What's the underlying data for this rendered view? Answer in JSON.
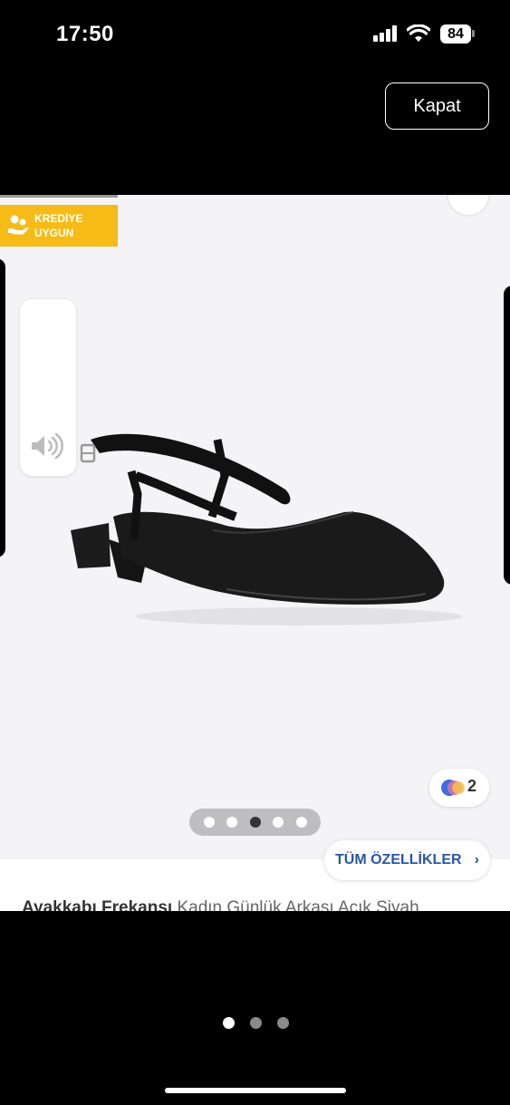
{
  "status_bar": {
    "time": "17:50",
    "battery": "84"
  },
  "header": {
    "close_label": "Kapat"
  },
  "gallery": {
    "credit_badge": {
      "line1": "KREDİYE",
      "line2": "UYGUN"
    },
    "variant_count": "2",
    "dots_total": 5,
    "dots_active_index": 2
  },
  "features_button": {
    "label": "TÜM ÖZELLİKLER",
    "chevron": "›"
  },
  "product": {
    "brand": "Ayakkabı Frekansı",
    "name": "Kadın Günlük Arkası Açık Siyah"
  },
  "story_pager": {
    "total": 3,
    "active_index": 0
  },
  "colors": {
    "badge": "#f6bb16",
    "link": "#2a55a8"
  }
}
